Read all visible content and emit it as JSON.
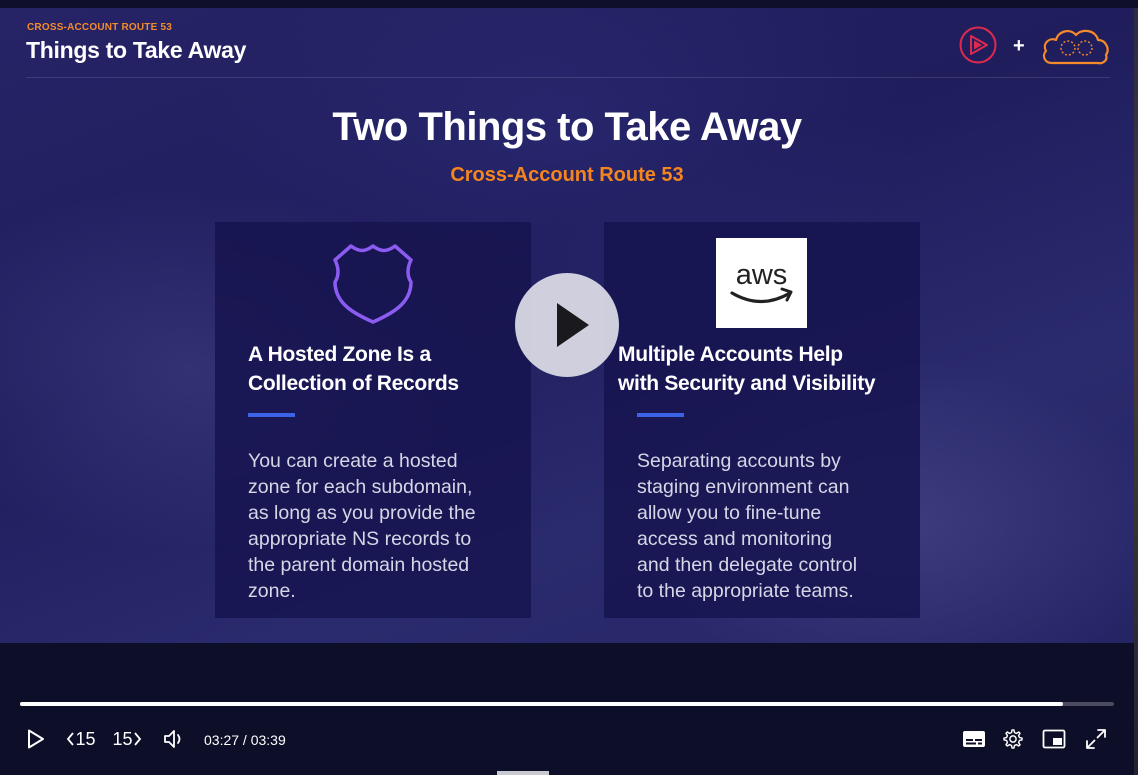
{
  "slide": {
    "kicker": "CROSS-ACCOUNT ROUTE 53",
    "header_title": "Things to Take Away",
    "logo_plus": "+",
    "title": "Two Things to Take Away",
    "subtitle": "Cross-Account Route 53",
    "cards": [
      {
        "icon": "shield-icon",
        "title_lines": [
          "A Hosted Zone Is a",
          "Collection of Records"
        ],
        "body_lines": [
          "You can create a hosted",
          "zone for each subdomain,",
          "as long as you provide the",
          "appropriate NS records to",
          "the parent domain hosted",
          "zone."
        ]
      },
      {
        "icon": "aws-logo-icon",
        "icon_text": "aws",
        "title_lines": [
          "Multiple Accounts Help",
          "with Security and Visibility"
        ],
        "body_lines": [
          "Separating accounts by",
          "staging environment can",
          "allow you to fine-tune",
          "access and monitoring",
          "and then delegate control",
          "to the appropriate teams."
        ]
      }
    ]
  },
  "player": {
    "current_time": "03:27",
    "duration": "03:39",
    "timecode": "03:27 / 03:39",
    "progress": 0.953,
    "skip_back_label": "15",
    "skip_forward_label": "15",
    "colors": {
      "accent_orange": "#f5851f",
      "rule_blue": "#3c63e6",
      "pluralsight_red": "#e0294f",
      "progress_fill": "#ffffff"
    }
  }
}
